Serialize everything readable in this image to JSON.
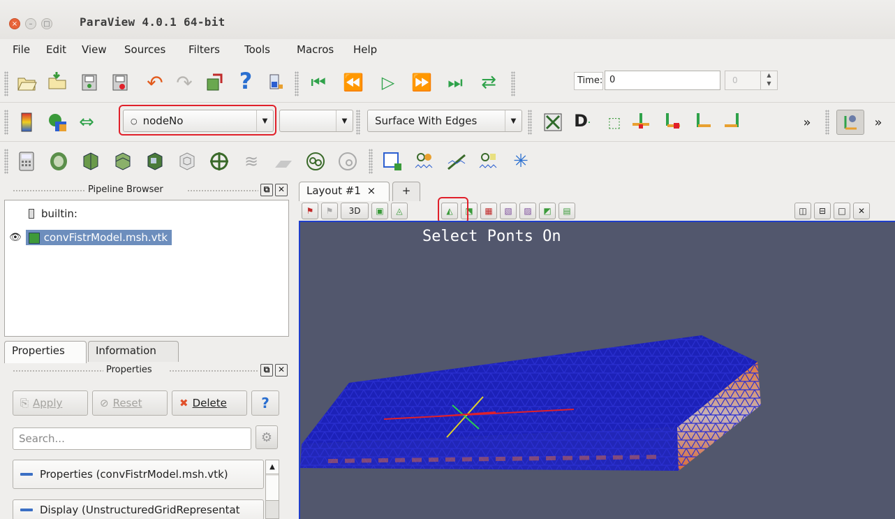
{
  "window": {
    "title": "ParaView 4.0.1 64-bit",
    "buttons": [
      "×",
      "–",
      "□"
    ]
  },
  "menu": [
    "File",
    "Edit",
    "View",
    "Sources",
    "Filters",
    "Tools",
    "Macros",
    "Help"
  ],
  "time": {
    "label": "Time:",
    "value": "0",
    "step": "0"
  },
  "color_by": {
    "selected": "nodeNo",
    "icon": "point-data-icon"
  },
  "component": {
    "selected": ""
  },
  "representation": {
    "selected": "Surface With Edges"
  },
  "overflow": "»",
  "pipeline": {
    "title": "Pipeline Browser",
    "items": [
      {
        "label": "builtin:",
        "icon": "server-icon"
      },
      {
        "label": "convFistrModel.msh.vtk",
        "icon": "data-source-icon",
        "visible_icon": "eye-icon"
      }
    ]
  },
  "left_tabs": [
    "Properties",
    "Information"
  ],
  "properties": {
    "title": "Properties",
    "apply": "Apply",
    "reset": "Reset",
    "delete": "Delete",
    "help": "?",
    "search_placeholder": "Search...",
    "sections": [
      "Properties (convFistrModel.msh.vtk)",
      "Display (UnstructuredGridRepresentat"
    ]
  },
  "layout": {
    "tab": "Layout #1",
    "close": "×",
    "add": "+"
  },
  "viewbar": {
    "mode_3d": "3D"
  },
  "view": {
    "annotation": "Select Ponts On",
    "background": "#52576d",
    "mesh_color": "#1a1fb4",
    "highlight": "#e0202a"
  }
}
